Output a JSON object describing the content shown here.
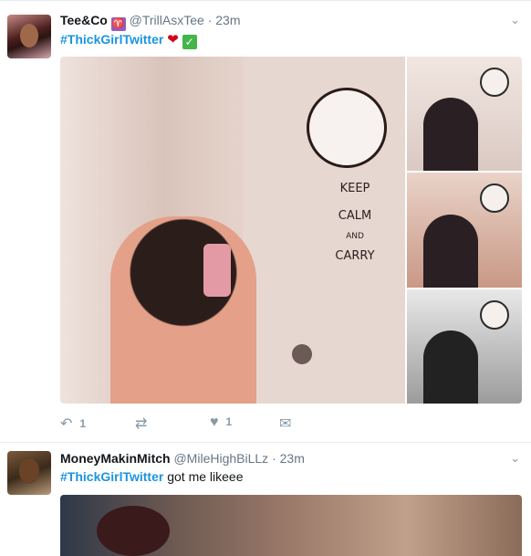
{
  "tweets": [
    {
      "name": "Tee&Co",
      "sign": "♈",
      "handle": "@TrillAsxTee",
      "separator": "·",
      "time": "23m",
      "hashtag": "#ThickGirlTwitter",
      "text_after": "",
      "emoji": [
        "heart",
        "check"
      ],
      "photo_text": {
        "line1": "KEEP",
        "line2": "CALM",
        "line3": "AND",
        "line4": "CARRY"
      },
      "actions": {
        "replies": "1",
        "retweets": "",
        "likes": "1"
      }
    },
    {
      "name": "MoneyMakinMitch",
      "handle": "@MileHighBiLLz",
      "separator": "·",
      "time": "23m",
      "hashtag": "#ThickGirlTwitter",
      "text_after": " got me likeee"
    }
  ],
  "icons": {
    "caret": "chevron-down-icon",
    "reply": "reply-icon",
    "retweet": "retweet-icon",
    "like": "heart-icon",
    "dm": "direct-message-icon"
  },
  "colors": {
    "link": "#1b95e0",
    "muted": "#657786",
    "heart": "#d0021b",
    "check": "#43b54a"
  }
}
